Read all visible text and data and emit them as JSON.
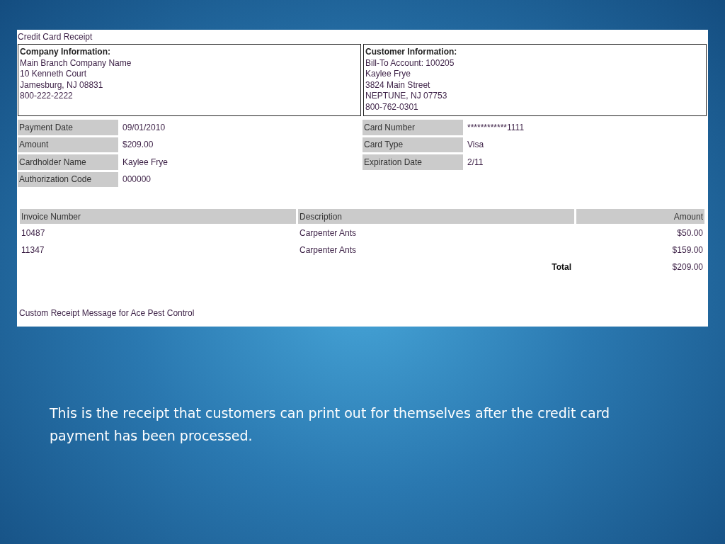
{
  "receipt": {
    "title": "Credit Card Receipt",
    "company": {
      "heading": "Company Information:",
      "lines": [
        "Main Branch Company Name",
        "10 Kenneth Court",
        "Jamesburg, NJ 08831",
        "800-222-2222"
      ]
    },
    "customer": {
      "heading": "Customer Information:",
      "lines": [
        "Bill-To Account: 100205",
        "Kaylee Frye",
        "3824 Main Street",
        "NEPTUNE, NJ 07753",
        "800-762-0301"
      ]
    },
    "payment_details": [
      {
        "label": "Payment Date",
        "value": "09/01/2010"
      },
      {
        "label": "Amount",
        "value": "$209.00"
      },
      {
        "label": "Cardholder Name",
        "value": "Kaylee Frye"
      },
      {
        "label": "Authorization Code",
        "value": "000000"
      }
    ],
    "card_details": [
      {
        "label": "Card Number",
        "value": "************1111"
      },
      {
        "label": "Card Type",
        "value": "Visa"
      },
      {
        "label": "Expiration Date",
        "value": "2/11"
      }
    ],
    "invoices": {
      "columns": [
        "Invoice Number",
        "Description",
        "Amount"
      ],
      "rows": [
        [
          "10487",
          "Carpenter Ants",
          "$50.00"
        ],
        [
          "11347",
          "Carpenter Ants",
          "$159.00"
        ]
      ],
      "total_label": "Total",
      "total_value": "$209.00"
    },
    "message": "Custom Receipt Message for Ace Pest Control"
  },
  "caption": "This is the receipt that customers can print out for themselves after the credit card payment has been processed."
}
